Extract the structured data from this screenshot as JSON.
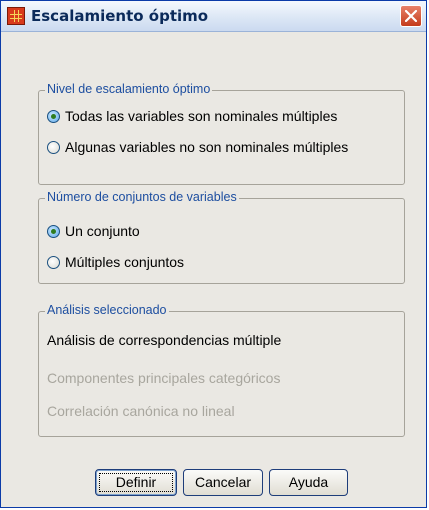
{
  "window": {
    "title": "Escalamiento óptimo",
    "icon": "spss-grid-icon",
    "close_icon": "close-icon"
  },
  "nivel": {
    "legend": "Nivel de escalamiento óptimo",
    "options": [
      {
        "label": "Todas las variables son nominales múltiples",
        "checked": true
      },
      {
        "label": "Algunas variables no son nominales múltiples",
        "checked": false
      }
    ]
  },
  "conjuntos": {
    "legend": "Número de conjuntos de variables",
    "options": [
      {
        "label": "Un conjunto",
        "checked": true
      },
      {
        "label": "Múltiples conjuntos",
        "checked": false
      }
    ]
  },
  "analisis": {
    "legend": "Análisis seleccionado",
    "items": [
      {
        "label": "Análisis de correspondencias múltiple",
        "enabled": true
      },
      {
        "label": "Componentes principales categóricos",
        "enabled": false
      },
      {
        "label": "Correlación canónica no lineal",
        "enabled": false
      }
    ]
  },
  "buttons": {
    "define": "Definir",
    "cancel": "Cancelar",
    "help": "Ayuda"
  },
  "colors": {
    "legend_text": "#1d4ea0",
    "disabled_text": "#a8a69e",
    "dialog_bg": "#eae8e3",
    "close_red": "#c43b1b"
  }
}
